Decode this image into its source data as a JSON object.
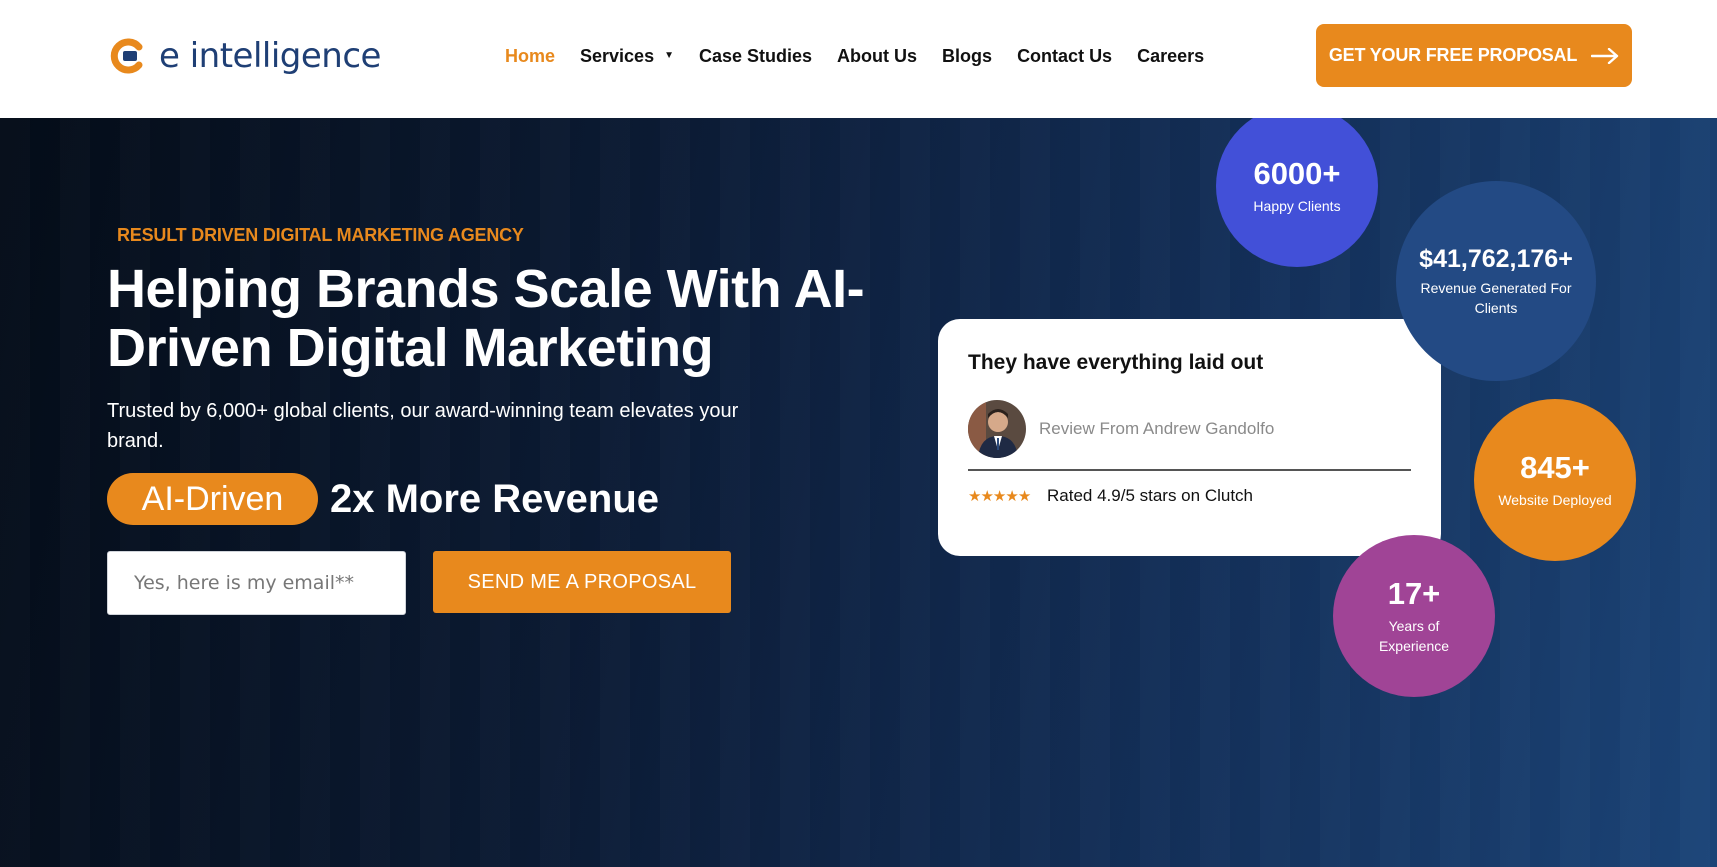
{
  "brand": {
    "name": "e intelligence"
  },
  "nav": {
    "items": [
      {
        "label": "Home",
        "active": true
      },
      {
        "label": "Services",
        "has_dropdown": true
      },
      {
        "label": "Case Studies"
      },
      {
        "label": "About Us"
      },
      {
        "label": "Blogs"
      },
      {
        "label": "Contact Us"
      },
      {
        "label": "Careers"
      }
    ],
    "cta_label": "GET YOUR FREE PROPOSAL"
  },
  "hero": {
    "eyebrow": "RESULT DRIVEN DIGITAL MARKETING AGENCY",
    "headline": "Helping Brands Scale With AI-Driven Digital Marketing",
    "subhead": "Trusted by 6,000+ global clients, our award-winning team elevates your brand.",
    "pill": "AI-Driven",
    "pill_follow": "2x More Revenue",
    "email_placeholder": "Yes, here is my email**",
    "email_value": "",
    "send_label": "SEND ME A PROPOSAL"
  },
  "review": {
    "title": "They have everything laid out",
    "reviewer": "Review From Andrew Gandolfo",
    "stars": 5,
    "rating_text": "Rated 4.9/5 stars on Clutch"
  },
  "stats": [
    {
      "value": "6000+",
      "label": "Happy Clients"
    },
    {
      "value": "$41,762,176+",
      "label": "Revenue Generated For Clients"
    },
    {
      "value": "845+",
      "label": "Website Deployed"
    },
    {
      "value": "17+",
      "label": "Years of Experience"
    }
  ],
  "colors": {
    "accent": "#e8891d",
    "brand_navy": "#1f3f75",
    "stat_blue": "#4250d8",
    "stat_navy": "#234a84",
    "stat_purple": "#a04496"
  },
  "icons": {
    "cta": "arrow-right-icon",
    "services": "caret-down-icon",
    "review": "star-icon"
  }
}
